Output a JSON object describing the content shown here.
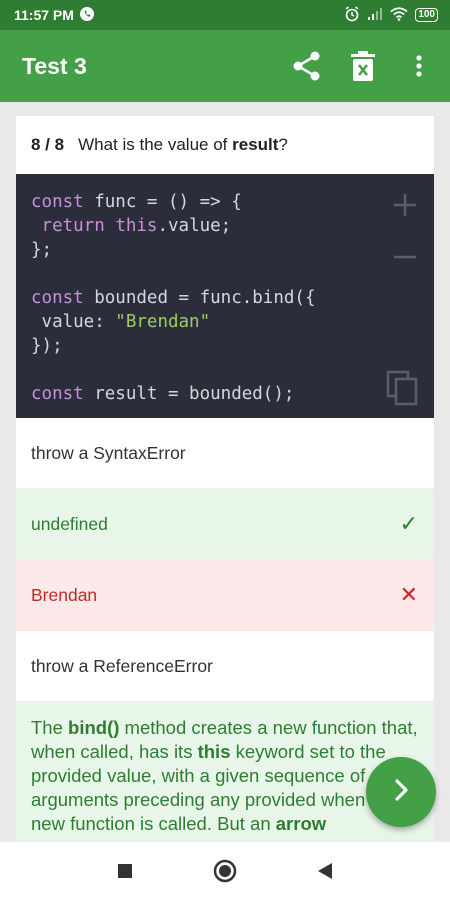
{
  "status": {
    "time": "11:57 PM",
    "battery": "100"
  },
  "appbar": {
    "title": "Test 3"
  },
  "question": {
    "counter": "8 / 8",
    "prefix": "What is the value of ",
    "keyword": "result",
    "suffix": "?"
  },
  "code": {
    "l1_kw": "const",
    "l1_rest": " func = () => {",
    "l2_indent": " ",
    "l2_kw1": "return",
    "l2_sp": " ",
    "l2_kw2": "this",
    "l2_rest": ".value;",
    "l3": "};",
    "l5_kw": "const",
    "l5_rest": " bounded = func.bind({",
    "l6_pre": " value: ",
    "l6_str": "\"Brendan\"",
    "l7": "});",
    "l9_kw": "const",
    "l9_rest": " result = bounded();"
  },
  "answers": [
    {
      "label": "throw a SyntaxError",
      "state": "neutral"
    },
    {
      "label": "undefined",
      "state": "correct",
      "mark": "✓"
    },
    {
      "label": "Brendan",
      "state": "wrong",
      "mark": "✕"
    },
    {
      "label": "throw a ReferenceError",
      "state": "neutral"
    }
  ],
  "explanation": {
    "t1": "The ",
    "b1": "bind()",
    "t2": " method creates a new function that, when called, has its ",
    "b2": "this",
    "t3": " keyword set to the provided value, with a given sequence of arguments preceding any provided when the new function is called. But an ",
    "b3": "arrow"
  },
  "colors": {
    "primary": "#43a047",
    "primary_dark": "#2e7d32",
    "code_bg": "#2b2e3a",
    "correct_bg": "#e8f5e9",
    "wrong_bg": "#fde9ea"
  },
  "icons": [
    "share-icon",
    "delete-icon",
    "more-vert-icon",
    "plus-icon",
    "minus-icon",
    "copy-icon",
    "chevron-right-icon",
    "recents-icon",
    "home-icon",
    "back-icon"
  ]
}
